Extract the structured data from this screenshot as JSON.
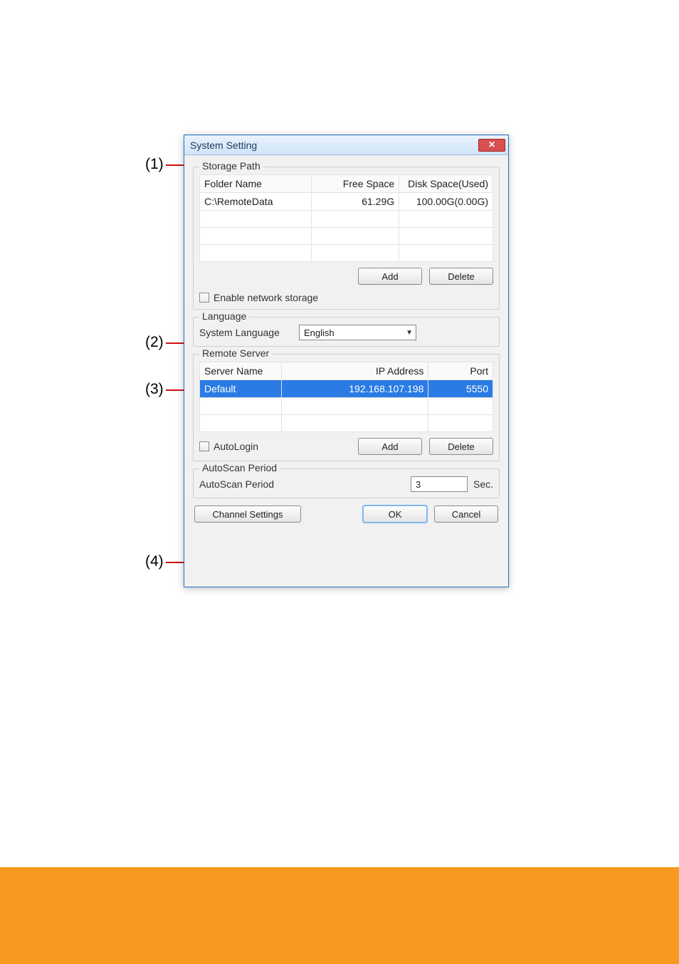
{
  "callouts": [
    "(1)",
    "(2)",
    "(3)",
    "(4)"
  ],
  "window": {
    "title": "System Setting"
  },
  "storage": {
    "legend": "Storage Path",
    "headers": [
      "Folder Name",
      "Free Space",
      "Disk Space(Used)"
    ],
    "rows": [
      {
        "folder": "C:\\RemoteData",
        "free": "61.29G",
        "disk": "100.00G(0.00G)"
      }
    ],
    "add_label": "Add",
    "delete_label": "Delete",
    "enable_storage_label": "Enable network storage",
    "enable_storage_checked": false
  },
  "language": {
    "legend": "Language",
    "label": "System Language",
    "value": "English"
  },
  "remote": {
    "legend": "Remote Server",
    "headers": [
      "Server Name",
      "IP Address",
      "Port"
    ],
    "rows": [
      {
        "name": "Default",
        "ip": "192.168.107.198",
        "port": "5550",
        "selected": true
      }
    ],
    "autologin_label": "AutoLogin",
    "autologin_checked": false,
    "add_label": "Add",
    "delete_label": "Delete"
  },
  "autoscan": {
    "legend": "AutoScan Period",
    "label": "AutoScan Period",
    "value": "3",
    "unit": "Sec."
  },
  "buttons": {
    "channel_settings": "Channel Settings",
    "ok": "OK",
    "cancel": "Cancel"
  }
}
